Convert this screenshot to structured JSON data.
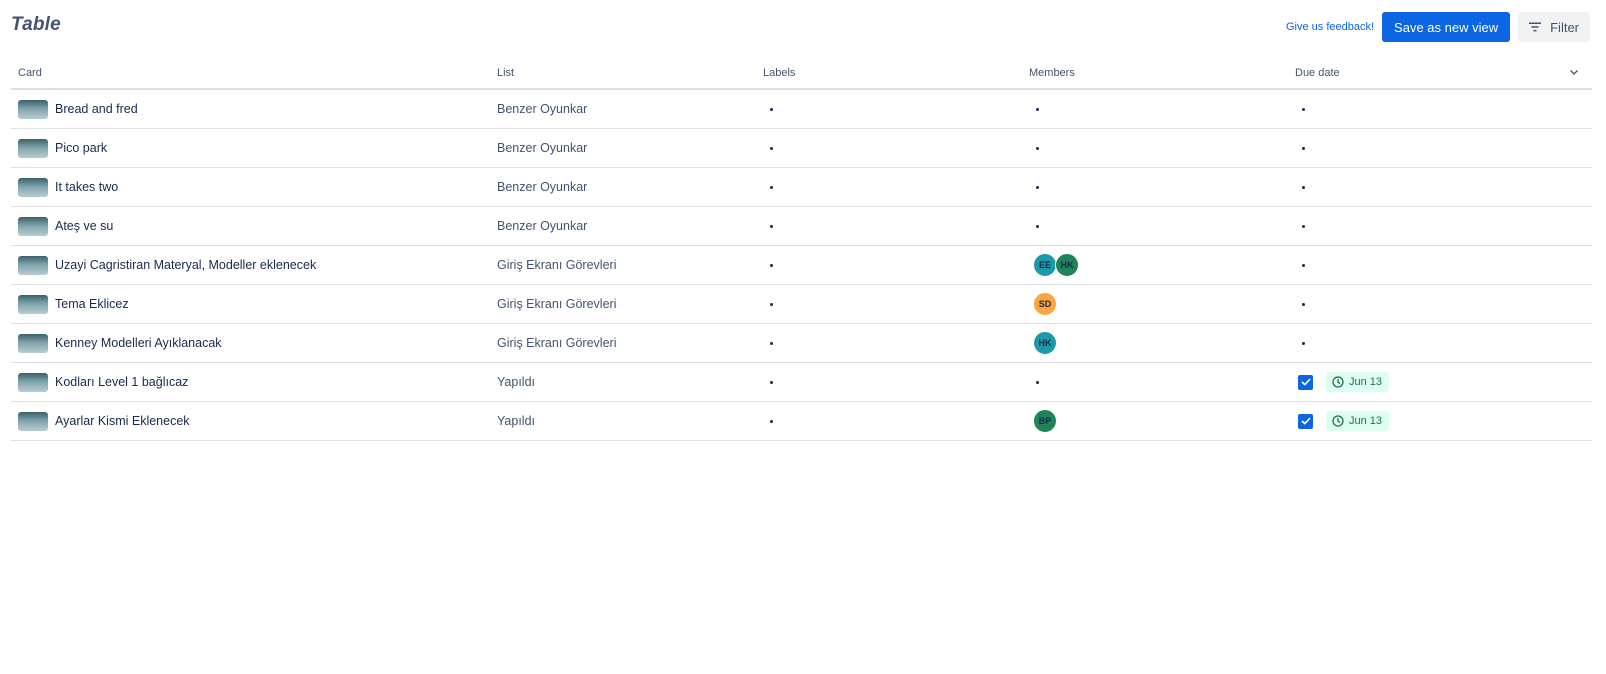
{
  "header": {
    "title": "Table",
    "feedback_link": "Give us feedback!",
    "save_view_label": "Save as new view",
    "filter_label": "Filter"
  },
  "columns": [
    "Card",
    "List",
    "Labels",
    "Members",
    "Due date"
  ],
  "rows": [
    {
      "card": "Bread and fred",
      "list": "Benzer Oyunkar",
      "members": [],
      "due": null
    },
    {
      "card": "Pico park",
      "list": "Benzer Oyunkar",
      "members": [],
      "due": null
    },
    {
      "card": "It takes two",
      "list": "Benzer Oyunkar",
      "members": [],
      "due": null
    },
    {
      "card": "Ateş ve su",
      "list": "Benzer Oyunkar",
      "members": [],
      "due": null
    },
    {
      "card": "Uzayi Cagristiran Materyal, Modeller eklenecek",
      "list": "Giriş Ekranı Görevleri",
      "members": [
        {
          "initials": "EE",
          "color": "#1d9aaa"
        },
        {
          "initials": "HK",
          "color": "#1f845a"
        }
      ],
      "due": null
    },
    {
      "card": "Tema Eklicez",
      "list": "Giriş Ekranı Görevleri",
      "members": [
        {
          "initials": "SD",
          "color": "#faa53d"
        }
      ],
      "due": null
    },
    {
      "card": "Kenney Modelleri Ayıklanacak",
      "list": "Giriş Ekranı Görevleri",
      "members": [
        {
          "initials": "HK",
          "color": "#1d9aaa"
        }
      ],
      "due": null
    },
    {
      "card": "Kodları Level 1 bağlıcaz",
      "list": "Yapıldı",
      "members": [],
      "due": {
        "checked": true,
        "date": "Jun 13"
      }
    },
    {
      "card": "Ayarlar Kismi Eklenecek",
      "list": "Yapıldı",
      "members": [
        {
          "initials": "BP",
          "color": "#1f845a"
        }
      ],
      "due": {
        "checked": true,
        "date": "Jun 13"
      }
    }
  ],
  "colors": {
    "accent": "#0c66e4",
    "due_complete_bg": "#dcfff1",
    "due_complete_text": "#216e4e"
  }
}
